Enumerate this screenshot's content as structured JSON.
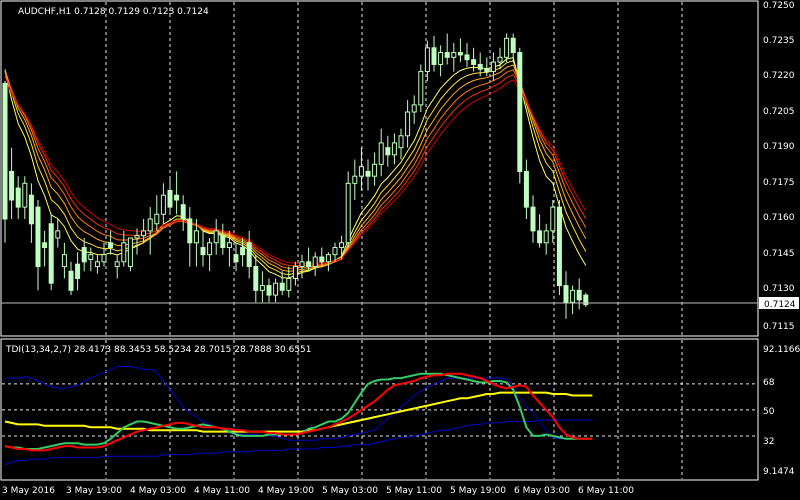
{
  "header": {
    "symbol_info": "AUDCHF,H1  0.7128 0.7129 0.7123 0.7124"
  },
  "indicator": {
    "label": "TDI(13,34,2,7) 28.4173 88.3453 58.5234 28.7015 28.7888 30.6551"
  },
  "price_axis": {
    "ticks": [
      "0.7250",
      "0.7235",
      "0.7220",
      "0.7205",
      "0.7190",
      "0.7175",
      "0.7160",
      "0.7145",
      "0.7130",
      "0.7115"
    ],
    "current_price": "0.7124"
  },
  "indicator_axis": {
    "ticks": [
      "92.1166",
      "68",
      "50",
      "32",
      "9.1474"
    ]
  },
  "time_axis": {
    "ticks": [
      "3 May 2016",
      "3 May 19:00",
      "4 May 03:00",
      "4 May 11:00",
      "4 May 19:00",
      "5 May 03:00",
      "5 May 11:00",
      "5 May 19:00",
      "6 May 03:00",
      "6 May 11:00"
    ]
  },
  "colors": {
    "background": "#000000",
    "frame": "#ffffff",
    "grid": "#ffffff",
    "candle": "#bfffbf",
    "ribbon_fast": "#ffff66",
    "ribbon_slow": "#cc0000",
    "tdi_green": "#33cc66",
    "tdi_red": "#ff0000",
    "tdi_yellow": "#ffff00",
    "tdi_blue": "#0000cc"
  },
  "chart_data": [
    {
      "type": "candlestick",
      "series": [
        {
          "values": [
            [
              0.7217,
              0.7218,
              0.715,
              0.716
            ],
            [
              0.718,
              0.719,
              0.716,
              0.7168
            ],
            [
              0.7173,
              0.7178,
              0.716,
              0.7165
            ],
            [
              0.7165,
              0.7178,
              0.716,
              0.7175
            ],
            [
              0.717,
              0.7175,
              0.715,
              0.7158
            ],
            [
              0.7165,
              0.7168,
              0.713,
              0.714
            ],
            [
              0.715,
              0.7155,
              0.714,
              0.7148
            ],
            [
              0.7158,
              0.7162,
              0.713,
              0.7133
            ],
            [
              0.7152,
              0.716,
              0.7148,
              0.7155
            ],
            [
              0.714,
              0.715,
              0.7135,
              0.7145
            ],
            [
              0.7138,
              0.7142,
              0.7128,
              0.713
            ],
            [
              0.7141,
              0.7146,
              0.713,
              0.7135
            ],
            [
              0.7148,
              0.7152,
              0.7138,
              0.7142
            ],
            [
              0.7143,
              0.7148,
              0.7138,
              0.7145
            ],
            [
              0.714,
              0.7145,
              0.7137,
              0.7142
            ],
            [
              0.7142,
              0.715,
              0.714,
              0.7145
            ],
            [
              0.715,
              0.7155,
              0.7145,
              0.7148
            ],
            [
              0.714,
              0.7145,
              0.7135,
              0.7142
            ],
            [
              0.7142,
              0.7155,
              0.714,
              0.715
            ],
            [
              0.714,
              0.7152,
              0.7138,
              0.7152
            ],
            [
              0.7152,
              0.7156,
              0.7145,
              0.7153
            ],
            [
              0.7153,
              0.716,
              0.715,
              0.7155
            ],
            [
              0.7155,
              0.7165,
              0.7145,
              0.716
            ],
            [
              0.7158,
              0.717,
              0.7155,
              0.7162
            ],
            [
              0.7162,
              0.7175,
              0.7158,
              0.717
            ],
            [
              0.7172,
              0.7177,
              0.7162,
              0.7165
            ],
            [
              0.717,
              0.718,
              0.7162,
              0.7168
            ],
            [
              0.7166,
              0.717,
              0.7155,
              0.716
            ],
            [
              0.716,
              0.7165,
              0.714,
              0.715
            ],
            [
              0.715,
              0.716,
              0.714,
              0.7155
            ],
            [
              0.7148,
              0.7155,
              0.714,
              0.7145
            ],
            [
              0.7145,
              0.7152,
              0.7138,
              0.715
            ],
            [
              0.715,
              0.716,
              0.7145,
              0.7155
            ],
            [
              0.7153,
              0.7158,
              0.7145,
              0.7148
            ],
            [
              0.7148,
              0.7155,
              0.714,
              0.715
            ],
            [
              0.7145,
              0.715,
              0.7138,
              0.7142
            ],
            [
              0.7148,
              0.7152,
              0.714,
              0.7145
            ],
            [
              0.715,
              0.7155,
              0.7135,
              0.714
            ],
            [
              0.714,
              0.7145,
              0.7125,
              0.713
            ],
            [
              0.713,
              0.7138,
              0.7125,
              0.7132
            ],
            [
              0.7132,
              0.7135,
              0.7125,
              0.7128
            ],
            [
              0.7128,
              0.7135,
              0.7125,
              0.7133
            ],
            [
              0.7133,
              0.7138,
              0.7128,
              0.713
            ],
            [
              0.713,
              0.714,
              0.7127,
              0.7135
            ],
            [
              0.7135,
              0.7142,
              0.7132,
              0.714
            ],
            [
              0.714,
              0.7145,
              0.7135,
              0.7142
            ],
            [
              0.7142,
              0.7148,
              0.7138,
              0.714
            ],
            [
              0.714,
              0.7146,
              0.7136,
              0.7144
            ],
            [
              0.7144,
              0.7148,
              0.714,
              0.7142
            ],
            [
              0.7142,
              0.7146,
              0.7138,
              0.7145
            ],
            [
              0.7145,
              0.715,
              0.7142,
              0.7148
            ],
            [
              0.7148,
              0.7153,
              0.7143,
              0.715
            ],
            [
              0.715,
              0.718,
              0.7148,
              0.7175
            ],
            [
              0.7175,
              0.7185,
              0.7168,
              0.7178
            ],
            [
              0.7178,
              0.719,
              0.7172,
              0.7182
            ],
            [
              0.718,
              0.7185,
              0.7172,
              0.7178
            ],
            [
              0.7178,
              0.7188,
              0.7174,
              0.7183
            ],
            [
              0.7183,
              0.7198,
              0.7178,
              0.7192
            ],
            [
              0.719,
              0.7195,
              0.7182,
              0.7187
            ],
            [
              0.7187,
              0.7196,
              0.7183,
              0.7192
            ],
            [
              0.719,
              0.7198,
              0.7185,
              0.7195
            ],
            [
              0.7195,
              0.721,
              0.719,
              0.7205
            ],
            [
              0.7205,
              0.7212,
              0.72,
              0.7208
            ],
            [
              0.7208,
              0.7225,
              0.7205,
              0.7222
            ],
            [
              0.7222,
              0.7235,
              0.7218,
              0.7232
            ],
            [
              0.7232,
              0.7237,
              0.7222,
              0.7225
            ],
            [
              0.7225,
              0.7233,
              0.722,
              0.723
            ],
            [
              0.723,
              0.7238,
              0.7225,
              0.7228
            ],
            [
              0.7228,
              0.7234,
              0.7222,
              0.723
            ],
            [
              0.723,
              0.7236,
              0.7226,
              0.7229
            ],
            [
              0.7229,
              0.7234,
              0.7224,
              0.7227
            ],
            [
              0.7227,
              0.7232,
              0.7222,
              0.7225
            ],
            [
              0.7225,
              0.723,
              0.722,
              0.7223
            ],
            [
              0.7223,
              0.7228,
              0.722,
              0.7222
            ],
            [
              0.7222,
              0.723,
              0.7218,
              0.7226
            ],
            [
              0.7226,
              0.7232,
              0.7223,
              0.7228
            ],
            [
              0.7228,
              0.7238,
              0.7226,
              0.7236
            ],
            [
              0.7236,
              0.7238,
              0.7226,
              0.723
            ],
            [
              0.723,
              0.7232,
              0.7175,
              0.718
            ],
            [
              0.718,
              0.7185,
              0.716,
              0.7165
            ],
            [
              0.7165,
              0.717,
              0.715,
              0.7155
            ],
            [
              0.7155,
              0.7162,
              0.7148,
              0.715
            ],
            [
              0.715,
              0.7158,
              0.7145,
              0.7155
            ],
            [
              0.7155,
              0.7168,
              0.715,
              0.7165
            ],
            [
              0.7165,
              0.7168,
              0.7128,
              0.7132
            ],
            [
              0.7132,
              0.7138,
              0.7118,
              0.7125
            ],
            [
              0.7125,
              0.7132,
              0.712,
              0.713
            ],
            [
              0.713,
              0.7135,
              0.7122,
              0.7126
            ],
            [
              0.7128,
              0.7129,
              0.7123,
              0.7124
            ]
          ]
        }
      ]
    },
    {
      "type": "line",
      "series": [
        {
          "values": [
            72,
            72,
            72,
            73,
            72,
            70,
            68,
            66,
            65,
            65,
            66,
            67,
            70,
            72,
            74,
            76,
            78,
            80,
            80,
            80,
            79,
            78,
            78,
            76,
            70,
            64,
            58,
            52,
            48,
            45,
            42,
            40,
            38,
            36,
            34,
            34,
            33,
            33,
            33,
            32,
            32,
            32,
            30,
            29,
            29,
            29,
            29,
            29,
            30,
            30,
            30,
            31,
            32,
            33,
            34,
            35,
            36,
            40,
            44,
            48,
            52,
            56,
            60,
            63,
            66,
            68,
            70,
            72,
            72,
            72,
            72,
            72,
            72,
            72,
            72,
            72,
            71,
            66,
            58,
            52,
            48,
            42,
            36,
            31,
            30,
            30,
            30,
            30,
            30,
            30
          ]
        },
        {
          "values": [
            12,
            14,
            15,
            15,
            16,
            16,
            16,
            17,
            17,
            17,
            17,
            17,
            17,
            17,
            17,
            18,
            18,
            18,
            18,
            18,
            18,
            18,
            18,
            18,
            19,
            19,
            19,
            19,
            19,
            20,
            20,
            20,
            20,
            21,
            21,
            21,
            21,
            21,
            22,
            22,
            22,
            22,
            22,
            23,
            23,
            23,
            23,
            23,
            24,
            24,
            24,
            25,
            25,
            26,
            26,
            26,
            27,
            28,
            29,
            30,
            31,
            31,
            32,
            33,
            34,
            35,
            36,
            36,
            37,
            38,
            39,
            40,
            40,
            41,
            41,
            41,
            42,
            42,
            42,
            42,
            42,
            43,
            43,
            43,
            43,
            43,
            43,
            43,
            43,
            43
          ]
        },
        {
          "values": [
            42,
            41,
            40,
            40,
            40,
            40,
            39,
            39,
            39,
            39,
            39,
            39,
            39,
            38,
            38,
            38,
            38,
            37,
            37,
            37,
            37,
            37,
            36,
            36,
            36,
            36,
            36,
            36,
            36,
            36,
            35,
            35,
            35,
            35,
            35,
            35,
            35,
            35,
            35,
            35,
            35,
            35,
            35,
            35,
            35,
            35,
            36,
            36,
            37,
            38,
            39,
            40,
            41,
            42,
            43,
            44,
            45,
            46,
            47,
            48,
            49,
            50,
            51,
            52,
            53,
            54,
            55,
            56,
            57,
            58,
            58,
            59,
            60,
            61,
            61,
            62,
            62,
            62,
            62,
            62,
            62,
            62,
            62,
            61,
            61,
            61,
            60,
            60,
            60,
            60
          ]
        },
        {
          "values": [
            25,
            24,
            23,
            23,
            22,
            22,
            22,
            23,
            24,
            25,
            25,
            24,
            24,
            24,
            24,
            25,
            27,
            29,
            31,
            33,
            35,
            36,
            37,
            38,
            39,
            40,
            41,
            41,
            40,
            39,
            38,
            38,
            38,
            37,
            37,
            36,
            36,
            35,
            35,
            35,
            34,
            34,
            33,
            33,
            33,
            34,
            35,
            36,
            37,
            38,
            40,
            42,
            44,
            47,
            50,
            53,
            56,
            60,
            64,
            67,
            68,
            69,
            70,
            72,
            73,
            74,
            74,
            75,
            75,
            75,
            74,
            73,
            72,
            70,
            68,
            66,
            65,
            66,
            67,
            66,
            60,
            55,
            50,
            45,
            38,
            33,
            31,
            30,
            30,
            30
          ]
        },
        {
          "values": [
            25,
            24,
            24,
            23,
            23,
            23,
            24,
            25,
            26,
            27,
            27,
            27,
            26,
            26,
            26,
            27,
            30,
            34,
            38,
            40,
            42,
            42,
            41,
            40,
            39,
            38,
            37,
            37,
            38,
            39,
            40,
            39,
            38,
            37,
            35,
            33,
            32,
            32,
            32,
            32,
            33,
            33,
            33,
            33,
            33,
            34,
            37,
            38,
            40,
            42,
            42,
            44,
            48,
            55,
            62,
            68,
            70,
            71,
            71,
            72,
            72,
            73,
            74,
            75,
            75,
            75,
            75,
            74,
            73,
            72,
            71,
            70,
            69,
            69,
            70,
            70,
            69,
            64,
            52,
            38,
            32,
            32,
            33,
            32,
            31,
            30,
            30,
            30,
            30,
            30
          ]
        }
      ]
    }
  ]
}
